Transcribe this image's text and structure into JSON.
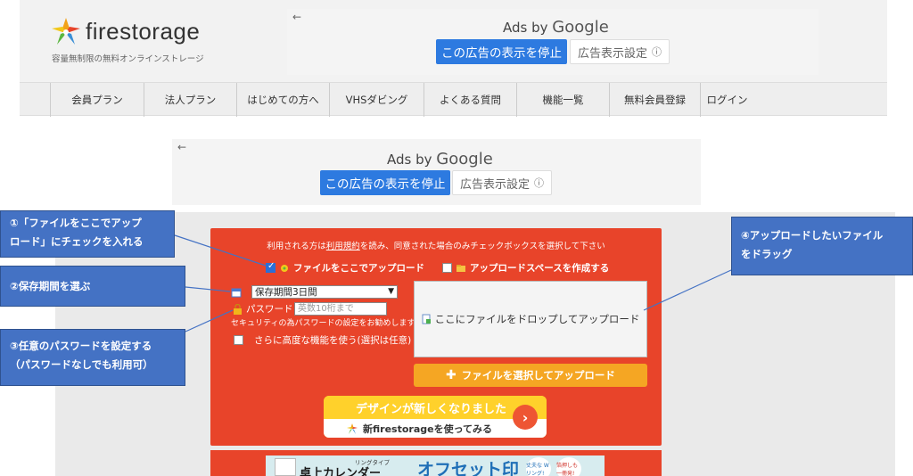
{
  "header": {
    "logo_text": "firestorage",
    "logo_sub": "容量無制限の無料オンラインストレージ"
  },
  "ads": {
    "back_arrow": "←",
    "ads_by": "Ads by",
    "google": "Google",
    "stop_label": "この広告の表示を停止",
    "settings_label": "広告表示設定",
    "info_icon": "ⓘ"
  },
  "nav": {
    "items": [
      "会員プラン",
      "法人プラン",
      "はじめての方へ",
      "VHSダビング",
      "よくある質問",
      "機能一覧",
      "無料会員登録",
      "ログイン"
    ]
  },
  "panel": {
    "note_pre": "利用される方は",
    "note_link": "利用規約",
    "note_post": "を読み、同意された場合のみチェックボックスを選択して下さい",
    "upload_here": "ファイルをここでアップロード",
    "create_space": "アップロードスペースを作成する",
    "period_selected": "保存期間3日間",
    "password_label": "パスワード",
    "password_placeholder": "英数10桁まで",
    "password_hint": "セキュリティの為パスワードの設定をお勧めします",
    "advanced": "さらに高度な機能を使う(選択は任意)",
    "dropzone_text": "ここにファイルをドロップしてアップロード",
    "pick_button": "ファイルを選択してアップロード",
    "promo_title": "デザインが新しくなりました",
    "promo_sub": "新firestorageを使ってみる",
    "promo_arrow": "›"
  },
  "banner": {
    "small": "リングタイプ",
    "calendar": "卓上カレンダー",
    "offset": "オフセット印",
    "badge1": "丈夫な Wリング!",
    "badge2": "箔押しも 一冊発!"
  },
  "callouts": {
    "c1_line1": "①「ファイルをここでアップ",
    "c1_line2": "ロード」にチェックを入れる",
    "c2": "②保存期間を選ぶ",
    "c3_line1": "③任意のパスワードを設定する",
    "c3_line2": "（パスワードなしでも利用可）",
    "c4_line1": "④アップロードしたいファイル",
    "c4_line2": "をドラッグ"
  },
  "colors": {
    "panel_red": "#e8442a",
    "callout_blue": "#4472c4",
    "ad_blue": "#2d7ae0",
    "orange": "#f5a623"
  }
}
